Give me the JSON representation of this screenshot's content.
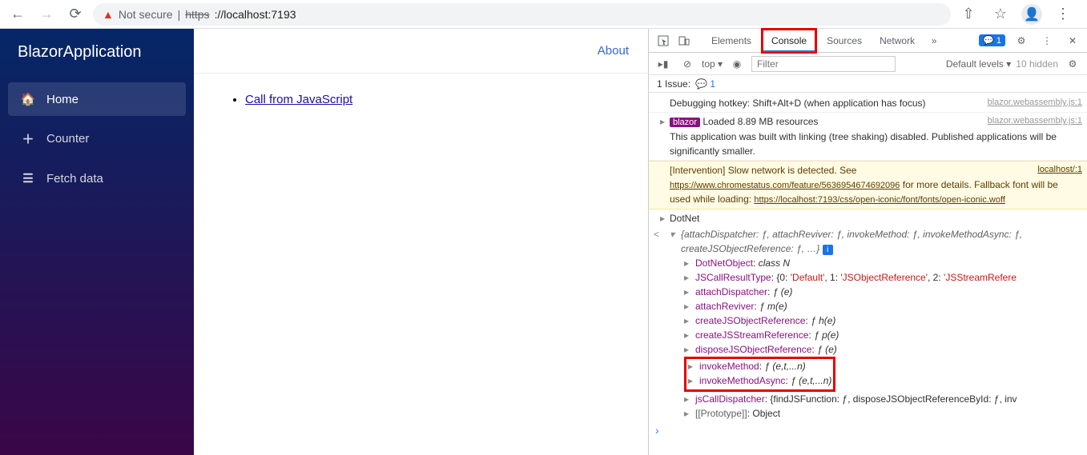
{
  "browser": {
    "not_secure": "Not secure",
    "url_scheme": "https",
    "url_rest": "://localhost:7193"
  },
  "sidebar": {
    "brand": "BlazorApplication",
    "items": [
      {
        "label": "Home",
        "icon": "home-icon"
      },
      {
        "label": "Counter",
        "icon": "plus-icon"
      },
      {
        "label": "Fetch data",
        "icon": "list-icon"
      }
    ]
  },
  "topbar": {
    "about": "About"
  },
  "page": {
    "link": "Call from JavaScript"
  },
  "devtools": {
    "tabs": {
      "elements": "Elements",
      "console": "Console",
      "sources": "Sources",
      "network": "Network"
    },
    "msg_badge": "1",
    "toolbar": {
      "top": "top ▾",
      "filter_ph": "Filter",
      "levels": "Default levels ▾",
      "hidden": "10 hidden"
    },
    "issues": {
      "label": "1 Issue:",
      "count": "1"
    },
    "logs": {
      "l1a": "Debugging hotkey: Shift+Alt+D (when application has focus)",
      "src1": "blazor.webassembly.js:1",
      "l2a": "Loaded 8.89 MB resources",
      "l2b": "This application was built with linking (tree shaking) disabled. Published applications will be significantly smaller.",
      "src2": "blazor.webassembly.js:1",
      "w1": "[Intervention] Slow network is detected. See ",
      "w1link": "https://www.chromestatus.com/feature/5636954674692096",
      "w2": " for more details. Fallback font will be used while loading: ",
      "w2link": "https://localhost:7193/css/open-iconic/font/fonts/open-iconic.woff",
      "wsrc": "localhost/:1",
      "dotnet": "DotNet",
      "objhead": "{attachDispatcher: ƒ, attachReviver: ƒ, invokeMethod: ƒ, invokeMethodAsync: ƒ, createJSObjectReference: ƒ, …}",
      "p1k": "DotNetObject",
      "p1v": "class N",
      "p2k": "JSCallResultType",
      "p2a": "{0: ",
      "p2b": "'Default'",
      "p2c": ", 1: ",
      "p2d": "'JSObjectReference'",
      "p2e": ", 2: ",
      "p2f": "'JSStreamRefere",
      "p3k": "attachDispatcher",
      "p3v": "ƒ (e)",
      "p4k": "attachReviver",
      "p4v": "ƒ m(e)",
      "p5k": "createJSObjectReference",
      "p5v": "ƒ h(e)",
      "p6k": "createJSStreamReference",
      "p6v": "ƒ p(e)",
      "p7k": "disposeJSObjectReference",
      "p7v": "ƒ (e)",
      "p8k": "invokeMethod",
      "p8v": "ƒ (e,t,...n)",
      "p9k": "invokeMethodAsync",
      "p9v": "ƒ (e,t,...n)",
      "p10k": "jsCallDispatcher",
      "p10v": "{findJSFunction: ƒ, disposeJSObjectReferenceById: ƒ, inv",
      "p11k": "[[Prototype]]",
      "p11v": "Object"
    }
  }
}
